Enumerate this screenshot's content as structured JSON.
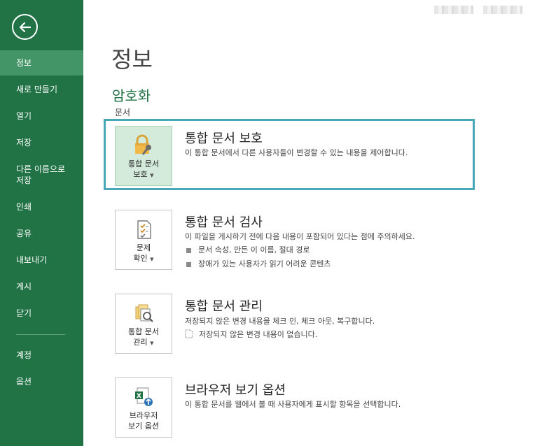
{
  "sidebar": {
    "items": [
      {
        "label": "정보",
        "active": true
      },
      {
        "label": "새로 만들기"
      },
      {
        "label": "열기"
      },
      {
        "label": "저장"
      },
      {
        "label": "다른 이름으로 저장"
      },
      {
        "label": "인쇄"
      },
      {
        "label": "공유"
      },
      {
        "label": "내보내기"
      },
      {
        "label": "게시"
      },
      {
        "label": "닫기"
      },
      {
        "label": "계정"
      },
      {
        "label": "옵션"
      }
    ],
    "item4_line1": "다른 이름으로",
    "item4_line2": "저장",
    "bg_color": "#217346",
    "active_color": "#439467"
  },
  "main": {
    "title": "정보",
    "section_title": "암호화",
    "section_sub": "문서",
    "cards": [
      {
        "icon": "lock-icon",
        "tile_line1": "통합 문서",
        "tile_line2": "보호",
        "title": "통합 문서 보호",
        "desc": "이 통합 문서에서 다른 사용자들이 변경할 수 있는 내용을 제어합니다."
      },
      {
        "icon": "inspect-document-icon",
        "tile_line1": "문제",
        "tile_line2": "확인",
        "title": "통합 문서 검사",
        "desc": "이 파일을 게시하기 전에 다음 내용이 포함되어 있다는 점에 주의하세요.",
        "bullets": [
          "문서 속성, 만든 이 이름, 절대 경로",
          "장애가 있는 사용자가 읽기 어려운 콘텐츠"
        ]
      },
      {
        "icon": "manage-workbook-icon",
        "tile_line1": "통합 문서",
        "tile_line2": "관리",
        "title": "통합 문서 관리",
        "desc": "저장되지 않은 변경 내용을 체크 인, 체크 아웃, 복구합니다.",
        "note": "저장되지 않은 변경 내용이 없습니다."
      },
      {
        "icon": "browser-view-icon",
        "tile_line1": "브라우저",
        "tile_line2": "보기 옵션",
        "title": "브라우저 보기 옵션",
        "desc": "이 통합 문서를 웹에서 볼 때 사용자에게 표시할 항목을 선택합니다."
      }
    ],
    "highlight_color": "#4aa7b8"
  }
}
